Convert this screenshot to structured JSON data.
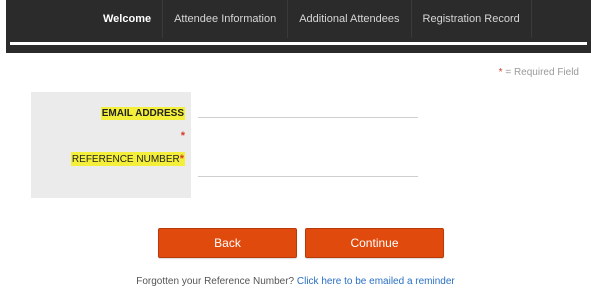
{
  "nav": {
    "tabs": [
      {
        "label": "Welcome",
        "active": true
      },
      {
        "label": "Attendee Information",
        "active": false
      },
      {
        "label": "Additional Attendees",
        "active": false
      },
      {
        "label": "Registration Record",
        "active": false
      }
    ]
  },
  "required_note": {
    "star": "*",
    "text": " = Required Field"
  },
  "form": {
    "email": {
      "label": "EMAIL ADDRESS",
      "required_mark": "*",
      "value": ""
    },
    "reference": {
      "label": "REFERENCE NUMBER",
      "required_mark": "*",
      "value": ""
    }
  },
  "buttons": {
    "back": "Back",
    "continue": "Continue"
  },
  "footer": {
    "prompt": "Forgotten your Reference Number? ",
    "link": "Click here to be emailed a reminder"
  },
  "colors": {
    "nav_bg": "#2b2b2b",
    "button": "#e04a0c",
    "highlight": "#f4ef3a",
    "required": "#d63a2a",
    "link": "#2a6fc2"
  }
}
